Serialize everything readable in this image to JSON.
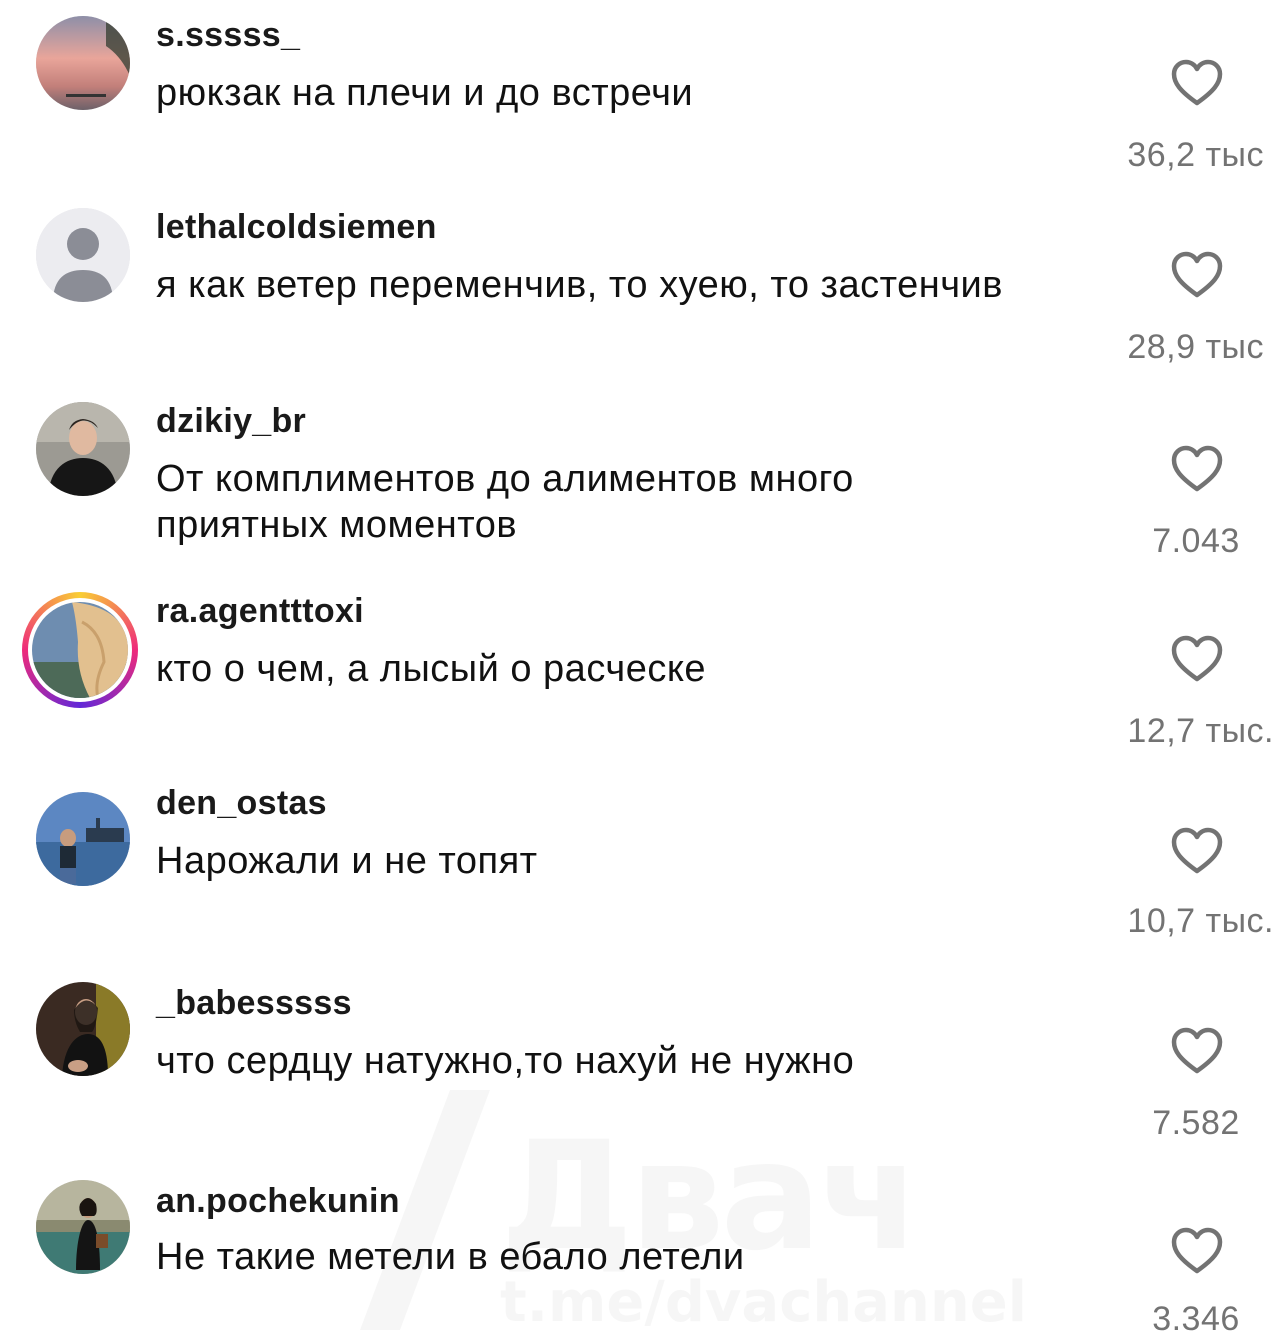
{
  "comments": [
    {
      "username": "s.sssss_",
      "text": "рюкзак на плечи и до встречи",
      "likes": "36,2 тыс",
      "avatar": "sunset-sky-photo"
    },
    {
      "username": "lethalcoldsiemen",
      "text": "я как ветер переменчив, то хуею, то застенчив",
      "likes": "28,9 тыс",
      "avatar": "default-user-silhouette"
    },
    {
      "username": "dzikiy_br",
      "text": "От комплиментов до алиментов много приятных моментов",
      "likes": "7.043",
      "avatar": "man-portrait-photo"
    },
    {
      "username": "ra.agentttoxi",
      "text": "кто о чем, а лысый о расческе",
      "likes": "12,7 тыс.",
      "avatar": "blonde-hair-photo-with-story-ring"
    },
    {
      "username": "den_ostas",
      "text": "Нарожали и не топят",
      "likes": "10,7 тыс.",
      "avatar": "harbor-photo"
    },
    {
      "username": "_babesssss",
      "text": "что сердцу натужно,то нахуй не нужно",
      "likes": "7.582",
      "avatar": "woman-dark-photo"
    },
    {
      "username": "an.pochekunin",
      "text": "Не такие метели в ебало летели",
      "likes": "3.346",
      "avatar": "fountain-photo"
    }
  ],
  "icons": {
    "like": "heart-outline-icon"
  },
  "watermark": {
    "logo_text": "Двач",
    "url": "t.me/dvachannel"
  },
  "colors": {
    "text": "#111111",
    "meta": "#737373",
    "story_ring_start": "#f9ce34",
    "story_ring_mid": "#ee2a7b"
  }
}
